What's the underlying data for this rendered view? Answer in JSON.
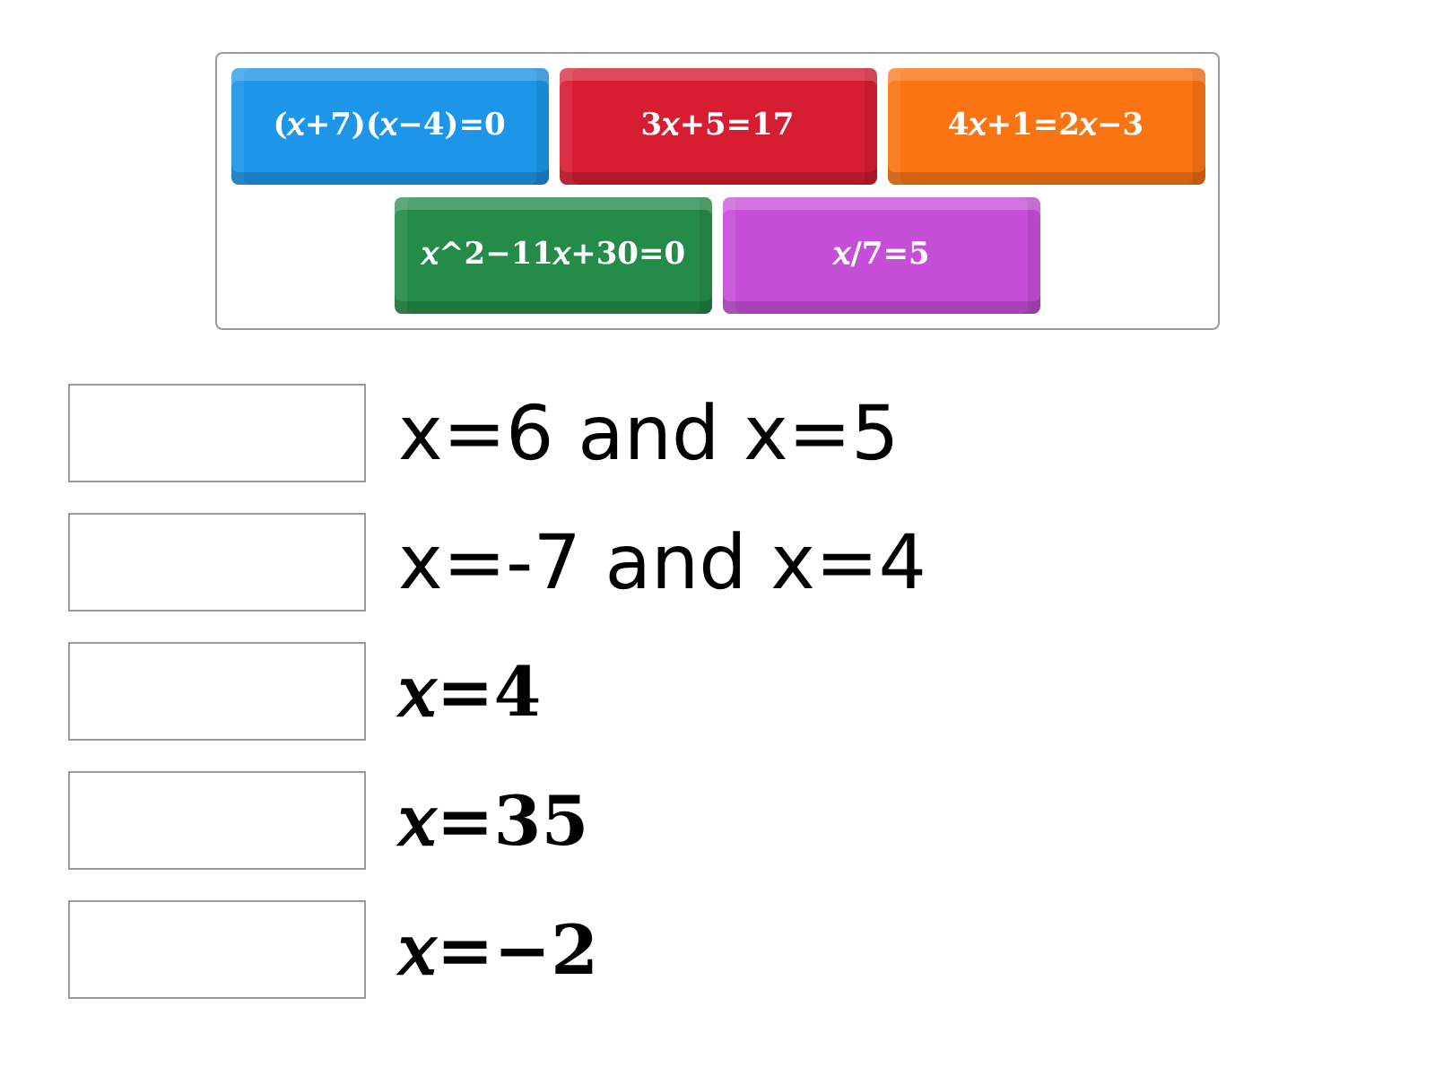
{
  "tiles": [
    {
      "label": "(𝑥+7)(𝑥−4)=0",
      "color": "#1d95e8"
    },
    {
      "label": "3𝑥+5=17",
      "color": "#d71d31"
    },
    {
      "label": "4𝑥+1=2𝑥−3",
      "color": "#fb7412"
    },
    {
      "label": "𝑥^2−11𝑥+30=0",
      "color": "#248c48"
    },
    {
      "label": "𝑥/7=5",
      "color": "#c64fd8"
    }
  ],
  "answers": [
    {
      "kind": "plain",
      "text": "x=6 and x=5"
    },
    {
      "kind": "plain",
      "text": "x=-7 and x=4"
    },
    {
      "kind": "math",
      "text": "𝑥=4"
    },
    {
      "kind": "math",
      "text": "𝑥=35"
    },
    {
      "kind": "math",
      "text": "𝑥=−2"
    }
  ]
}
